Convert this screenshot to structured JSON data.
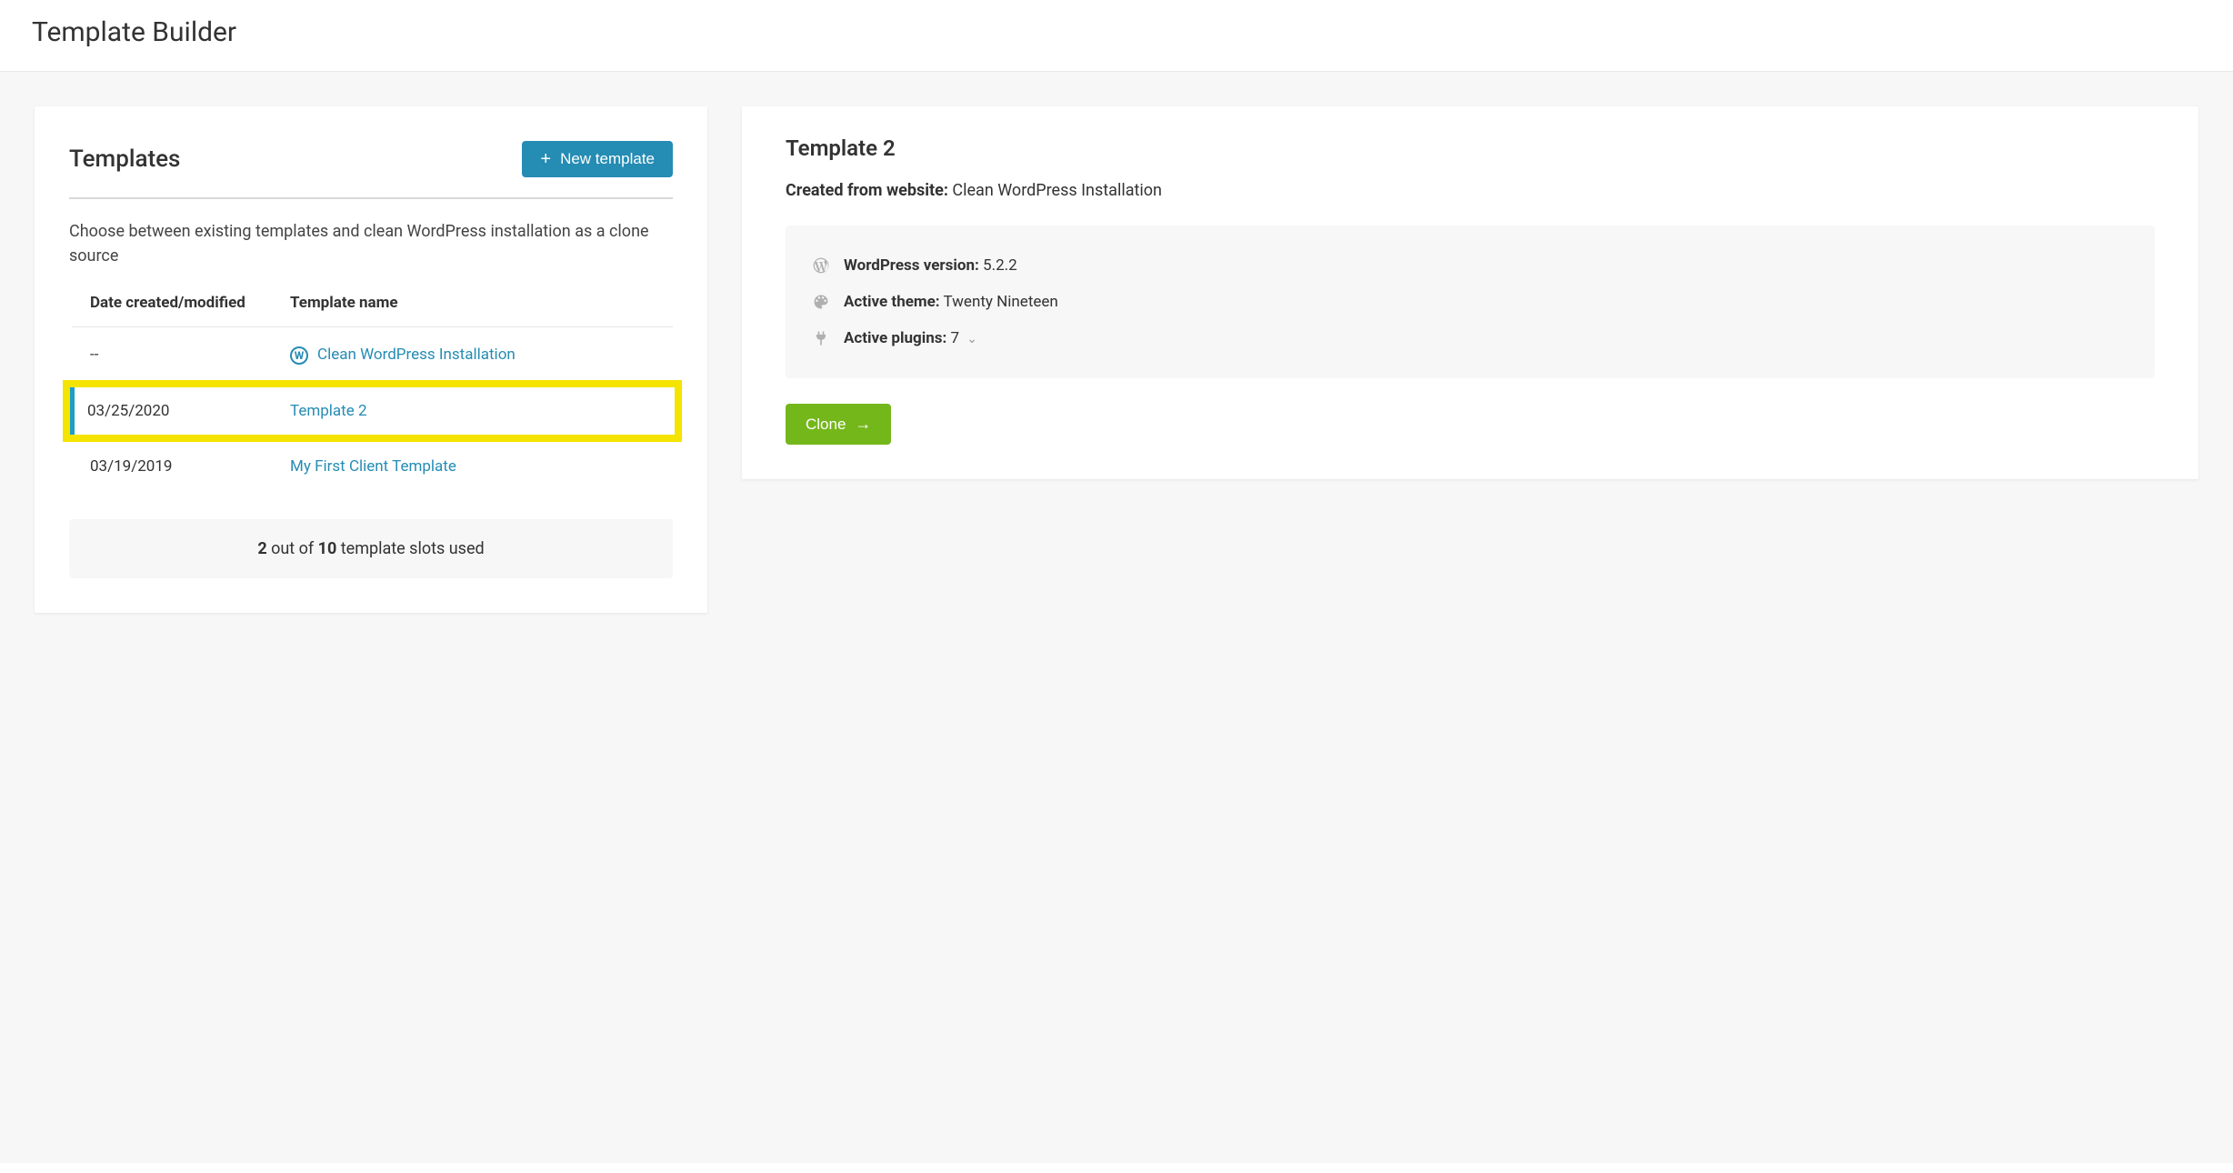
{
  "page": {
    "title": "Template Builder"
  },
  "templates_panel": {
    "title": "Templates",
    "new_button": "New template",
    "description": "Choose between existing templates and clean WordPress installation as a clone source",
    "columns": {
      "date": "Date created/modified",
      "name": "Template name"
    },
    "rows": [
      {
        "date": "--",
        "name": "Clean WordPress Installation",
        "icon": true,
        "selected": false,
        "highlighted": false
      },
      {
        "date": "03/25/2020",
        "name": "Template 2",
        "icon": false,
        "selected": true,
        "highlighted": true
      },
      {
        "date": "03/19/2019",
        "name": "My First Client Template",
        "icon": false,
        "selected": false,
        "highlighted": false
      }
    ],
    "footer": {
      "used": "2",
      "mid": " out of ",
      "total": "10",
      "suffix": " template slots used"
    }
  },
  "detail_panel": {
    "title": "Template 2",
    "created_label": "Created from website:",
    "created_value": "Clean WordPress Installation",
    "wp_version_label": "WordPress version:",
    "wp_version_value": "5.2.2",
    "theme_label": "Active theme:",
    "theme_value": "Twenty Nineteen",
    "plugins_label": "Active plugins:",
    "plugins_value": "7",
    "clone_button": "Clone"
  }
}
